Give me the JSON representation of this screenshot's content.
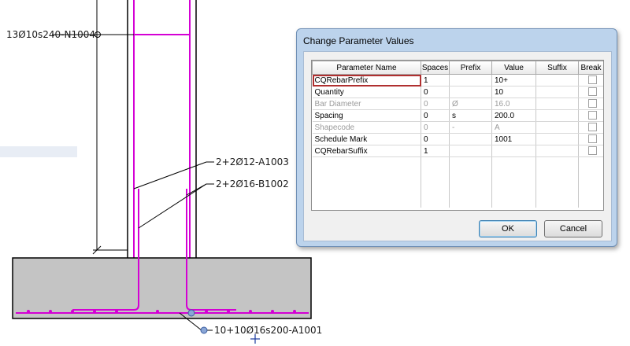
{
  "drawing": {
    "labels": {
      "top_bar": "13Ø10s240-N1004",
      "mid_bar_1": "2+2Ø12-A1003",
      "mid_bar_2": "2+2Ø16-B1002",
      "bottom_bar": "10+10Ø16s200-A1001"
    },
    "colors": {
      "rebar": "#d400d4",
      "concrete": "#c4c4c4",
      "line": "#000000"
    }
  },
  "dialog": {
    "title": "Change Parameter Values",
    "columns": [
      "Parameter Name",
      "Spaces",
      "Prefix",
      "Value",
      "Suffix",
      "Break"
    ],
    "rows": [
      {
        "name": "CQRebarPrefix",
        "spaces": "1",
        "prefix": "",
        "value": "10+",
        "suffix": "",
        "enabled": true,
        "selected": true
      },
      {
        "name": "Quantity",
        "spaces": "0",
        "prefix": "",
        "value": "10",
        "suffix": "",
        "enabled": true
      },
      {
        "name": "Bar Diameter",
        "spaces": "0",
        "prefix": "Ø",
        "value": "16.0",
        "suffix": "",
        "enabled": false
      },
      {
        "name": "Spacing",
        "spaces": "0",
        "prefix": "s",
        "value": "200.0",
        "suffix": "",
        "enabled": true
      },
      {
        "name": "Shapecode",
        "spaces": "0",
        "prefix": "-",
        "value": "A",
        "suffix": "",
        "enabled": false
      },
      {
        "name": "Schedule Mark",
        "spaces": "0",
        "prefix": "",
        "value": "1001",
        "suffix": "",
        "enabled": true
      },
      {
        "name": "CQRebarSuffix",
        "spaces": "1",
        "prefix": "",
        "value": "",
        "suffix": "",
        "enabled": true
      }
    ],
    "ok_label": "OK",
    "cancel_label": "Cancel"
  }
}
